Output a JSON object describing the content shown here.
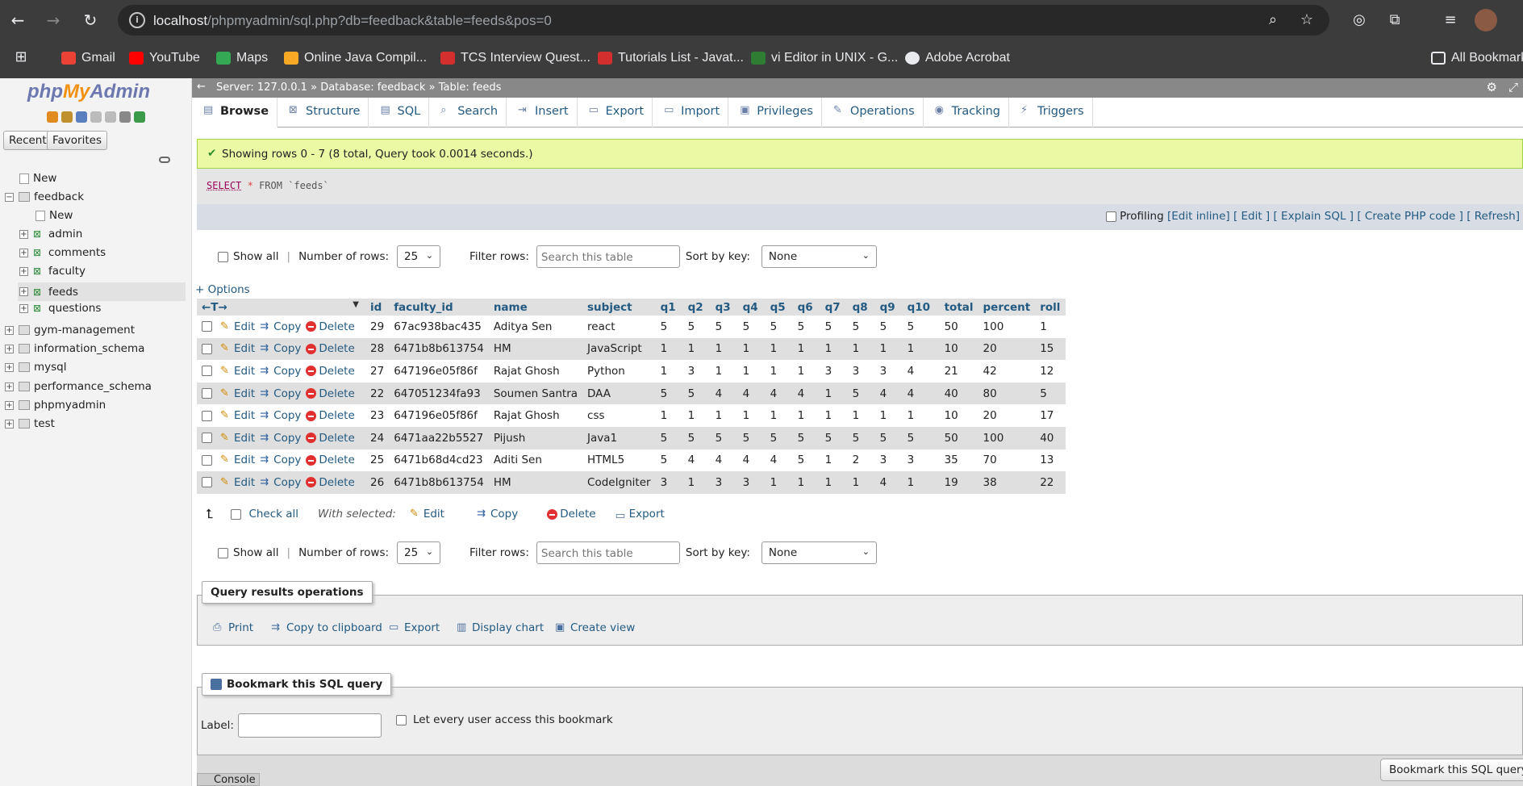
{
  "browser": {
    "url_host": "localhost",
    "url_path": "/phpmyadmin/sql.php?db=feedback&table=feeds&pos=0",
    "bookmarks": [
      "Gmail",
      "YouTube",
      "Maps",
      "Online Java Compil...",
      "TCS Interview Quest...",
      "Tutorials List - Javat...",
      "vi Editor in UNIX - G...",
      "Adobe Acrobat"
    ],
    "all_bookmarks": "All Bookmark"
  },
  "sidebar": {
    "logo_php": "php",
    "logo_my": "My",
    "logo_admin": "Admin",
    "recent": "Recent",
    "favorites": "Favorites",
    "tree": [
      {
        "label": "New",
        "level": 0
      },
      {
        "label": "feedback",
        "level": 0
      },
      {
        "label": "New",
        "level": 1
      },
      {
        "label": "admin",
        "level": 1
      },
      {
        "label": "comments",
        "level": 1
      },
      {
        "label": "faculty",
        "level": 1
      },
      {
        "label": "feeds",
        "level": 1
      },
      {
        "label": "questions",
        "level": 1
      },
      {
        "label": "gym-management",
        "level": 0
      },
      {
        "label": "information_schema",
        "level": 0
      },
      {
        "label": "mysql",
        "level": 0
      },
      {
        "label": "performance_schema",
        "level": 0
      },
      {
        "label": "phpmyadmin",
        "level": 0
      },
      {
        "label": "test",
        "level": 0
      }
    ]
  },
  "breadcrumb": {
    "server": "Server: 127.0.0.1",
    "database": "Database: feedback",
    "table": "Table: feeds",
    "sep": "»"
  },
  "tabs": [
    "Browse",
    "Structure",
    "SQL",
    "Search",
    "Insert",
    "Export",
    "Import",
    "Privileges",
    "Operations",
    "Tracking",
    "Triggers"
  ],
  "message": "Showing rows 0 - 7 (8 total, Query took 0.0014 seconds.)",
  "sql": {
    "select": "SELECT",
    "star": "*",
    "from": "FROM",
    "table": "`feeds`"
  },
  "sql_actions": {
    "profiling": "Profiling",
    "links": [
      "[Edit inline]",
      "[ Edit ]",
      "[ Explain SQL ]",
      "[ Create PHP code ]",
      "[ Refresh]"
    ]
  },
  "nav": {
    "show_all": "Show all",
    "number_of_rows": "Number of rows:",
    "rows_value": "25",
    "filter_rows": "Filter rows:",
    "filter_placeholder": "Search this table",
    "sort_by_key": "Sort by key:",
    "sort_value": "None"
  },
  "options": "+ Options",
  "table": {
    "arrows": "←T→",
    "columns": [
      "id",
      "faculty_id",
      "name",
      "subject",
      "q1",
      "q2",
      "q3",
      "q4",
      "q5",
      "q6",
      "q7",
      "q8",
      "q9",
      "q10",
      "total",
      "percent",
      "roll"
    ],
    "actions": {
      "edit": "Edit",
      "copy": "Copy",
      "delete": "Delete"
    },
    "rows": [
      [
        "29",
        "67ac938bac435",
        "Aditya Sen",
        "react",
        "5",
        "5",
        "5",
        "5",
        "5",
        "5",
        "5",
        "5",
        "5",
        "5",
        "50",
        "100",
        "1"
      ],
      [
        "28",
        "6471b8b613754",
        "HM",
        "JavaScript",
        "1",
        "1",
        "1",
        "1",
        "1",
        "1",
        "1",
        "1",
        "1",
        "1",
        "10",
        "20",
        "15"
      ],
      [
        "27",
        "647196e05f86f",
        "Rajat Ghosh",
        "Python",
        "1",
        "3",
        "1",
        "1",
        "1",
        "1",
        "3",
        "3",
        "3",
        "4",
        "21",
        "42",
        "12"
      ],
      [
        "22",
        "647051234fa93",
        "Soumen Santra",
        "DAA",
        "5",
        "5",
        "4",
        "4",
        "4",
        "4",
        "1",
        "5",
        "4",
        "4",
        "40",
        "80",
        "5"
      ],
      [
        "23",
        "647196e05f86f",
        "Rajat Ghosh",
        "css",
        "1",
        "1",
        "1",
        "1",
        "1",
        "1",
        "1",
        "1",
        "1",
        "1",
        "10",
        "20",
        "17"
      ],
      [
        "24",
        "6471aa22b5527",
        "Pijush",
        "Java1",
        "5",
        "5",
        "5",
        "5",
        "5",
        "5",
        "5",
        "5",
        "5",
        "5",
        "50",
        "100",
        "40"
      ],
      [
        "25",
        "6471b68d4cd23",
        "Aditi Sen",
        "HTML5",
        "5",
        "4",
        "4",
        "4",
        "4",
        "5",
        "1",
        "2",
        "3",
        "3",
        "35",
        "70",
        "13"
      ],
      [
        "26",
        "6471b8b613754",
        "HM",
        "CodeIgniter",
        "3",
        "1",
        "3",
        "3",
        "1",
        "1",
        "1",
        "1",
        "4",
        "1",
        "19",
        "38",
        "22"
      ]
    ]
  },
  "with_selected": {
    "check_all": "Check all",
    "label": "With selected:",
    "edit": "Edit",
    "copy": "Copy",
    "delete": "Delete",
    "export": "Export"
  },
  "query_ops": {
    "legend": "Query results operations",
    "items": [
      "Print",
      "Copy to clipboard",
      "Export",
      "Display chart",
      "Create view"
    ]
  },
  "bookmark": {
    "legend": "Bookmark this SQL query",
    "label": "Label:",
    "let_every": "Let every user access this bookmark",
    "button": "Bookmark this SQL query"
  },
  "console": "Console"
}
